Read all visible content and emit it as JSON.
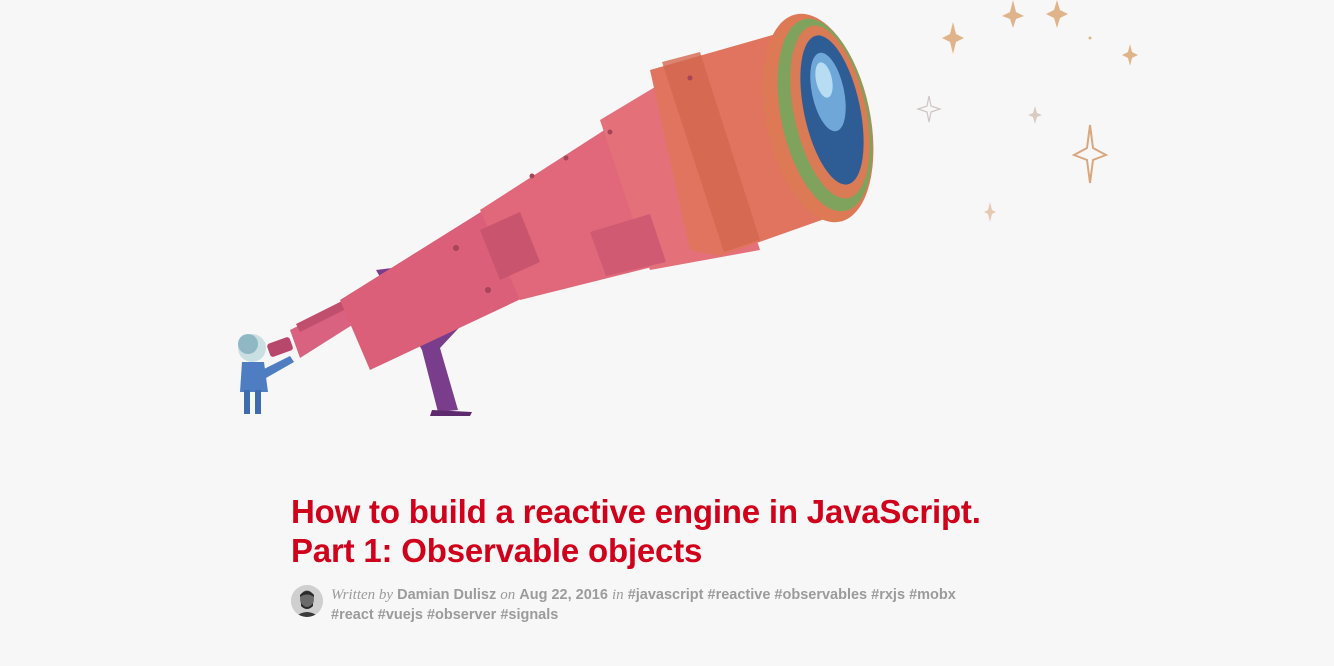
{
  "post": {
    "title_line1": "How to build a reactive engine in JavaScript.",
    "title_line2": "Part 1: Observable objects",
    "written_by_label": "Written by",
    "author": "Damian Dulisz",
    "on_label": "on",
    "date": "Aug 22, 2016",
    "in_label": "in",
    "tags": [
      "#javascript",
      "#reactive",
      "#observables",
      "#rxjs",
      "#mobx",
      "#react",
      "#vuejs",
      "#observer",
      "#signals"
    ]
  },
  "colors": {
    "title": "#d0021b",
    "meta": "#9b9b9b",
    "background": "#f8f7f8"
  }
}
